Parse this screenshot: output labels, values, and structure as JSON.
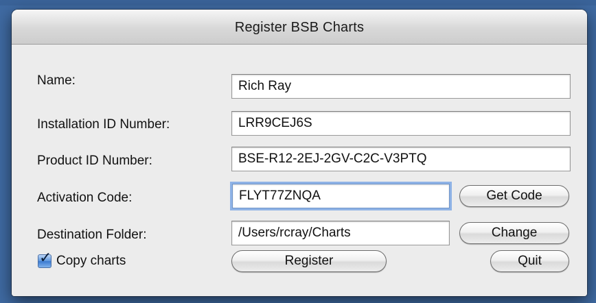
{
  "window": {
    "title": "Register BSB Charts"
  },
  "form": {
    "name_label": "Name:",
    "name_value": "Rich Ray",
    "installation_label": "Installation ID Number:",
    "installation_value": "LRR9CEJ6S",
    "product_label": "Product ID Number:",
    "product_value": "BSE-R12-2EJ-2GV-C2C-V3PTQ",
    "activation_label": "Activation Code:",
    "activation_value": "FLYT77ZNQA",
    "destination_label": "Destination Folder:",
    "destination_value": "/Users/rcray/Charts"
  },
  "buttons": {
    "get_code": "Get Code",
    "change": "Change",
    "register": "Register",
    "quit": "Quit"
  },
  "options": {
    "copy_charts_label": "Copy charts",
    "copy_charts_checked": true
  },
  "colors": {
    "desktop": "#3f6aa2",
    "window_bg": "#ececec",
    "focus_ring": "#8fb3e6",
    "checkbox_blue": "#3b7ad0"
  }
}
